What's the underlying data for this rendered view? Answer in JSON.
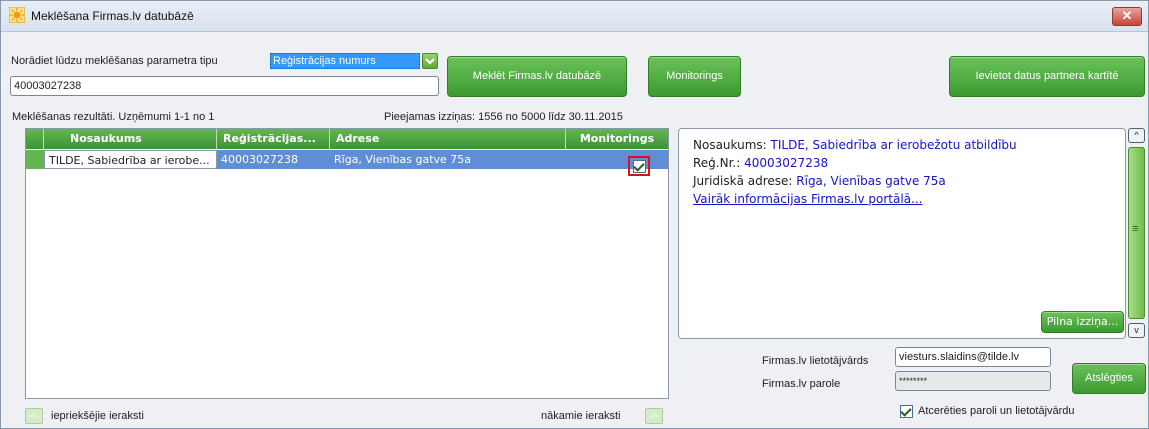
{
  "window": {
    "title": "Meklēšana Firmas.lv datubāzē",
    "close_symbol": "✕"
  },
  "search": {
    "type_label": "Norādiet lūdzu meklēšanas parametra tipu",
    "type_value": "Reģistrācijas numurs",
    "query_value": "40003027238"
  },
  "buttons": {
    "search": "Meklēt Firmas.lv datubāzē",
    "monitoring": "Monitorings",
    "insert": "Ievietot datus partnera kartītē",
    "full_report": "Pilna izziņa...",
    "disconnect": "Atslēgties"
  },
  "results": {
    "summary": "Meklēšanas rezultāti. Uzņēmumi 1-1 no 1",
    "available": "Pieejamas izziņas: 1556 no 5000 līdz 30.11.2015",
    "columns": [
      "Nosaukums",
      "Reģistrācijas...",
      "Adrese",
      "Monitorings"
    ],
    "rows": [
      {
        "name": "TILDE, Sabiedrība ar ierobe...",
        "reg": "40003027238",
        "address": "Rīga, Vienības gatve 75a",
        "monitoring": true
      }
    ]
  },
  "detail": {
    "name_label": "Nosaukums:",
    "name_value": "TILDE, Sabiedrība ar ierobežotu atbildību",
    "reg_label": "Reģ.Nr.:",
    "reg_value": "40003027238",
    "addr_label": "Juridiskā adrese:",
    "addr_value": "Rīga, Vienības gatve 75a",
    "more_link": "Vairāk informācijas Firmas.lv portālā..."
  },
  "login": {
    "user_label": "Firmas.lv lietotājvārds",
    "user_value": "viesturs.slaidins@tilde.lv",
    "pass_label": "Firmas.lv parole",
    "pass_value": "********",
    "remember_label": "Atcerēties paroli un lietotājvārdu",
    "remember_checked": true
  },
  "nav": {
    "prev_label": "iepriekšējie ieraksti",
    "next_label": "nākamie ieraksti",
    "prev_arrow": "<-",
    "next_arrow": "->"
  },
  "scroll": {
    "up": "^",
    "down": "v",
    "grip": "≡"
  },
  "colors": {
    "accent_green": "#4aa73c",
    "selection_blue": "#5f8ed4",
    "link_blue": "#1414c8"
  }
}
